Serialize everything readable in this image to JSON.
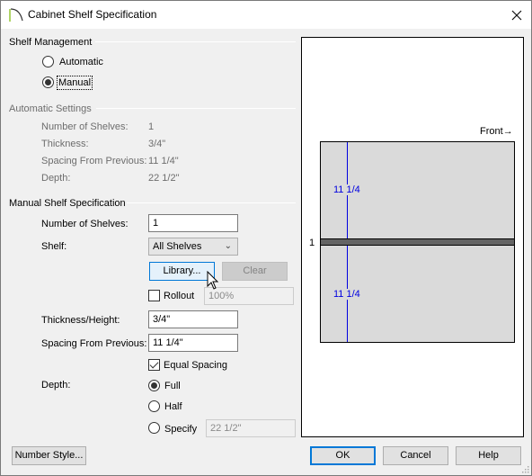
{
  "window": {
    "title": "Cabinet Shelf Specification",
    "icons": {
      "app": "arch-icon",
      "close": "close-icon"
    }
  },
  "shelf_management": {
    "label": "Shelf Management",
    "options": [
      {
        "label": "Automatic",
        "checked": false
      },
      {
        "label": "Manual",
        "checked": true
      }
    ]
  },
  "automatic_settings": {
    "label": "Automatic Settings",
    "rows": [
      {
        "label": "Number of Shelves:",
        "value": "1"
      },
      {
        "label": "Thickness:",
        "value": "3/4\""
      },
      {
        "label": "Spacing From Previous:",
        "value": "11 1/4\""
      },
      {
        "label": "Depth:",
        "value": "22 1/2\""
      }
    ]
  },
  "manual": {
    "label": "Manual Shelf Specification",
    "number_of_shelves_label": "Number of Shelves:",
    "number_of_shelves_value": "1",
    "shelf_label": "Shelf:",
    "shelf_value": "All Shelves",
    "library_button": "Library...",
    "clear_button": "Clear",
    "rollout_label": "Rollout",
    "rollout_checked": false,
    "rollout_value": "100%",
    "thickness_label": "Thickness/Height:",
    "thickness_value": "3/4\"",
    "spacing_label": "Spacing From Previous:",
    "spacing_value": "11 1/4\"",
    "equal_spacing_label": "Equal Spacing",
    "equal_spacing_checked": true,
    "depth_label": "Depth:",
    "depth_options": [
      {
        "label": "Full",
        "checked": true
      },
      {
        "label": "Half",
        "checked": false
      },
      {
        "label": "Specify",
        "checked": false
      }
    ],
    "specify_value": "22 1/2\""
  },
  "preview": {
    "front_label": "Front",
    "shelf_number": "1",
    "dim_top": "11 1/4",
    "dim_bottom": "11 1/4",
    "colors": {
      "cabinet": "#dadada",
      "shelf": "#646464",
      "dimension": "#0000e0"
    }
  },
  "footer": {
    "number_style_button": "Number Style...",
    "ok_button": "OK",
    "cancel_button": "Cancel",
    "help_button": "Help"
  }
}
